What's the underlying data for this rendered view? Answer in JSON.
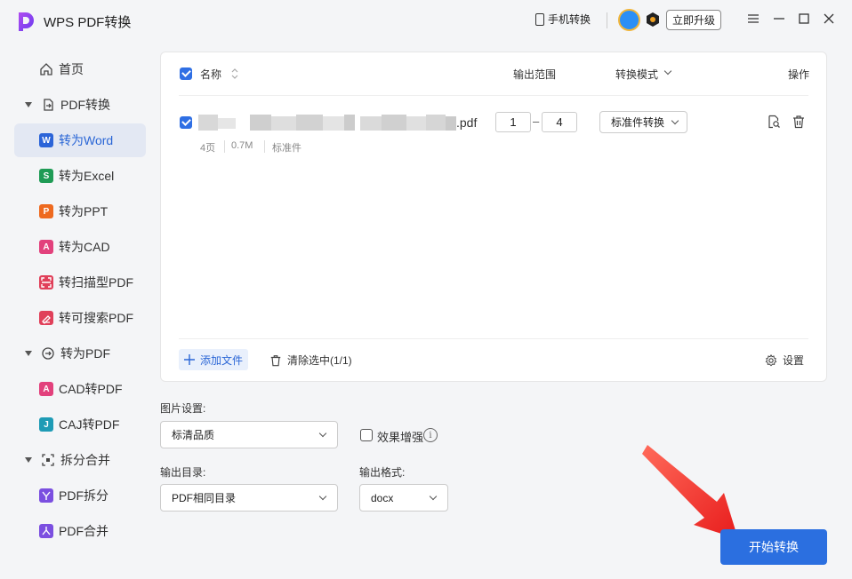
{
  "window": {
    "title": "WPS PDF转换",
    "mobile_label": "手机转换",
    "upgrade_label": "立即升级",
    "accent": "#2b6fe0"
  },
  "sidebar": {
    "home": "首页",
    "groups": [
      {
        "label": "PDF转换",
        "items": [
          "转为Word",
          "转为Excel",
          "转为PPT",
          "转为CAD",
          "转扫描型PDF",
          "转可搜索PDF"
        ]
      },
      {
        "label": "转为PDF",
        "items": [
          "CAD转PDF",
          "CAJ转PDF"
        ]
      },
      {
        "label": "拆分合并",
        "items": [
          "PDF拆分",
          "PDF合并"
        ]
      }
    ],
    "active": "转为Word",
    "icon_letters": {
      "word": "W",
      "excel": "S",
      "ppt": "P",
      "cad": "A",
      "cad2pdf": "A",
      "caj": "J"
    }
  },
  "table": {
    "headers": {
      "name": "名称",
      "range": "输出范围",
      "mode": "转换模式",
      "ops": "操作"
    },
    "file": {
      "ext": ".pdf",
      "range_from": "1",
      "range_to": "4",
      "mode": "标准件转换",
      "pages": "4页",
      "size": "0.7M",
      "type": "标准件"
    },
    "add_file": "添加文件",
    "clear_selected": "清除选中(1/1)",
    "settings": "设置"
  },
  "options": {
    "image_label": "图片设置:",
    "image_value": "标清品质",
    "enhance_label": "效果增强",
    "outdir_label": "输出目录:",
    "outdir_value": "PDF相同目录",
    "format_label": "输出格式:",
    "format_value": "docx"
  },
  "start_button": "开始转换"
}
